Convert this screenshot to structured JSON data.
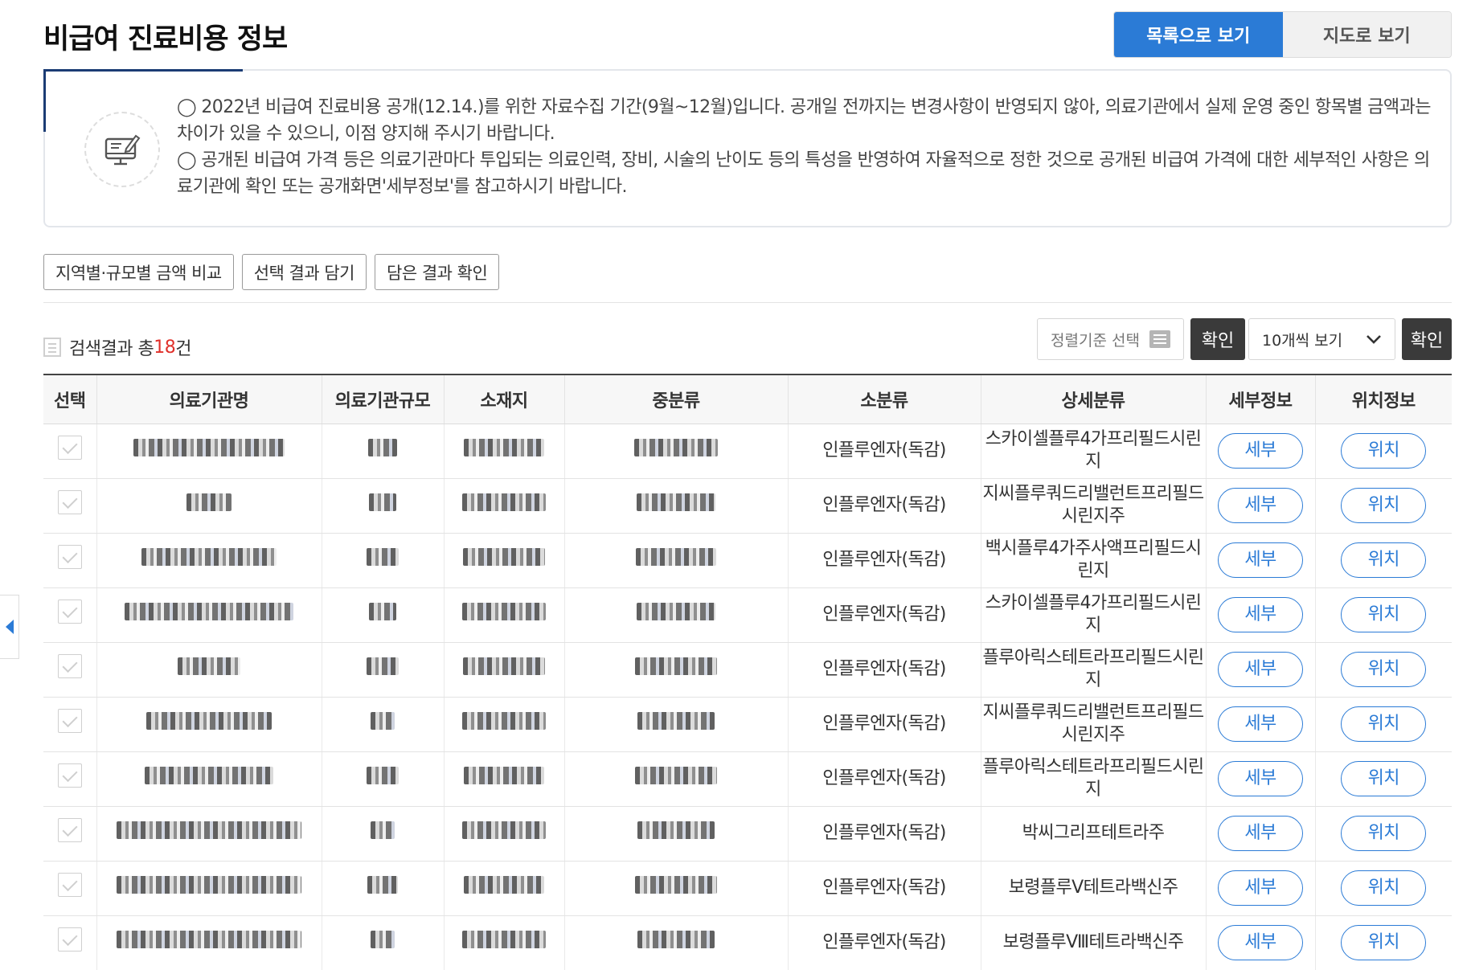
{
  "header": {
    "title": "비급여 진료비용 정보",
    "view_list": "목록으로 보기",
    "view_map": "지도로 보기"
  },
  "notice": {
    "lines": [
      "◯ 2022년 비급여 진료비용 공개(12.14.)를 위한 자료수집 기간(9월~12월)입니다. 공개일 전까지는 변경사항이 반영되지 않아, 의료기관에서 실제 운영 중인 항목별 금액과는 차이가 있을 수 있으니, 이점 양지해 주시기 바랍니다.",
      "◯ 공개된 비급여 가격 등은 의료기관마다 투입되는 의료인력, 장비, 시술의 난이도 등의 특성을 반영하여 자율적으로 정한 것으로 공개된 비급여 가격에 대한 세부적인 사항은 의료기관에 확인 또는 공개화면'세부정보'를 참고하시기 바랍니다."
    ]
  },
  "actions": {
    "compare": "지역별·규모별 금액 비교",
    "save_selection": "선택 결과 담기",
    "view_saved": "담은 결과 확인"
  },
  "results": {
    "prefix": "검색결과 총 ",
    "count": "18",
    "suffix": "건"
  },
  "controls": {
    "sort_placeholder": "정렬기준 선택",
    "sort_confirm": "확인",
    "per_page": "10개씩 보기",
    "per_page_confirm": "확인"
  },
  "table": {
    "headers": [
      "선택",
      "의료기관명",
      "의료기관규모",
      "소재지",
      "중분류",
      "소분류",
      "상세분류",
      "세부정보",
      "위치정보"
    ],
    "detail_label": "세부",
    "location_label": "위치",
    "rows": [
      {
        "sub": "인플루엔자(독감)",
        "detail": "스카이셀플루4가프리필드시린지"
      },
      {
        "sub": "인플루엔자(독감)",
        "detail": "지씨플루쿼드리밸런트프리필드시린지주"
      },
      {
        "sub": "인플루엔자(독감)",
        "detail": "백시플루4가주사액프리필드시린지"
      },
      {
        "sub": "인플루엔자(독감)",
        "detail": "스카이셀플루4가프리필드시린지"
      },
      {
        "sub": "인플루엔자(독감)",
        "detail": "플루아릭스테트라프리필드시린지"
      },
      {
        "sub": "인플루엔자(독감)",
        "detail": "지씨플루쿼드리밸런트프리필드시린지주"
      },
      {
        "sub": "인플루엔자(독감)",
        "detail": "플루아릭스테트라프리필드시린지"
      },
      {
        "sub": "인플루엔자(독감)",
        "detail": "박씨그리프테트라주"
      },
      {
        "sub": "인플루엔자(독감)",
        "detail": "보령플루Ⅴ테트라백신주"
      },
      {
        "sub": "인플루엔자(독감)",
        "detail": "보령플루Ⅷ테트라백신주"
      }
    ]
  },
  "icons": {
    "notice": "monitor-edit-icon",
    "list": "list-icon",
    "sort": "sort-list-icon",
    "chevron": "chevron-down-icon",
    "side": "caret-left-icon"
  },
  "colors": {
    "primary": "#2b7bd6",
    "count": "#e0302a",
    "dark_button": "#3a3a3a"
  }
}
